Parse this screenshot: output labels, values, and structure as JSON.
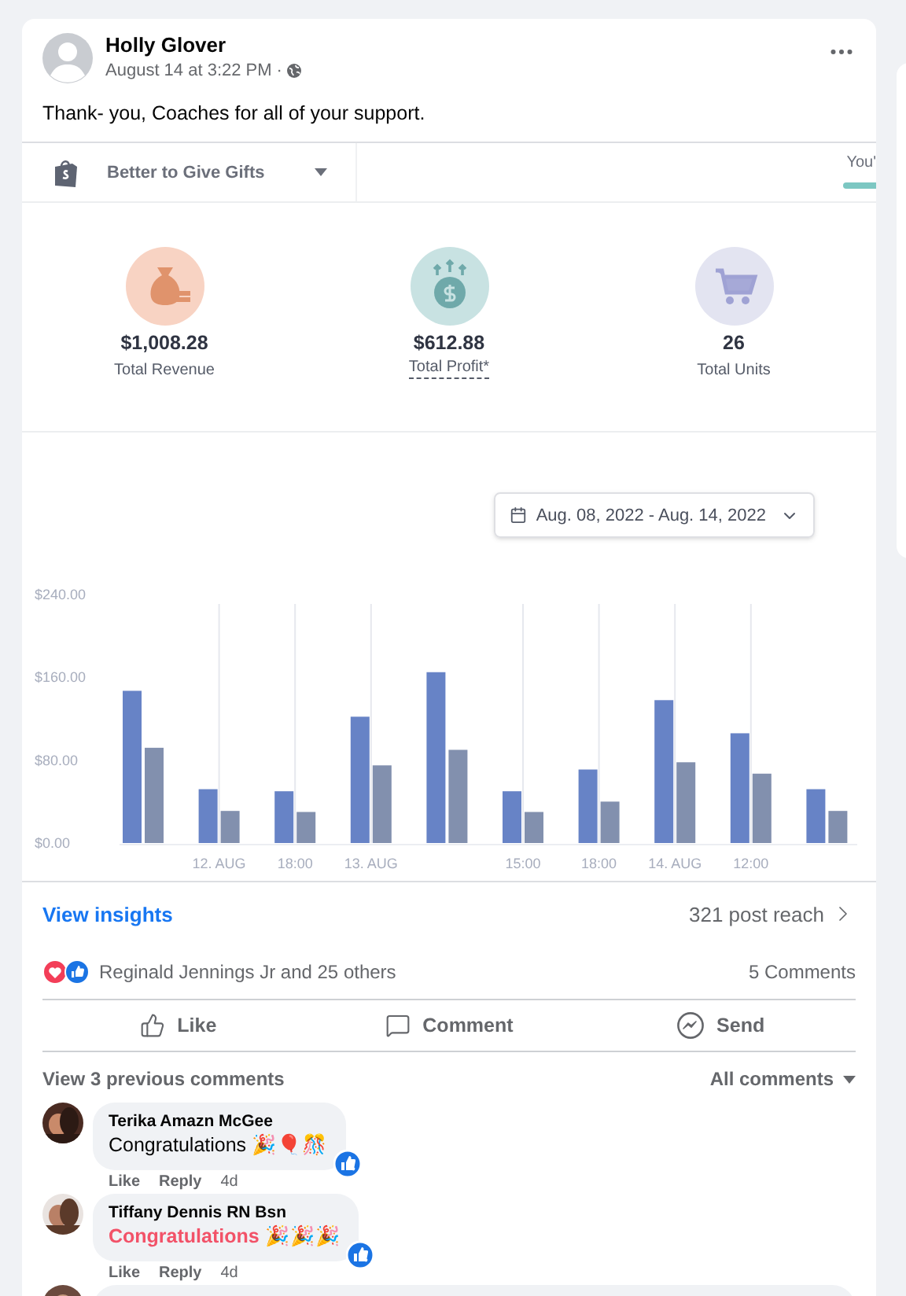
{
  "post": {
    "author": "Holly Glover",
    "time": "August 14 at 3:22 PM",
    "separator": "·",
    "text": "Thank- you, Coaches for all of your support."
  },
  "embed": {
    "store": "Better to Give Gifts",
    "cut_text": "You'",
    "stats": [
      {
        "kind": "revenue",
        "value": "$1,008.28",
        "label": "Total Revenue",
        "dotted": false
      },
      {
        "kind": "profit",
        "value": "$612.88",
        "label": "Total Profit*",
        "dotted": true
      },
      {
        "kind": "units",
        "value": "26",
        "label": "Total Units",
        "dotted": false
      }
    ],
    "date_range": "Aug. 08, 2022 - Aug. 14, 2022",
    "chart_data": {
      "type": "bar",
      "grid": true,
      "categories": [
        null,
        "12. AUG",
        "18:00",
        "13. AUG",
        null,
        "15:00",
        "18:00",
        "14. AUG",
        "12:00",
        null
      ],
      "yticks": [
        {
          "value": 0,
          "label": "$0.00"
        },
        {
          "value": 80,
          "label": "$80.00"
        },
        {
          "value": 160,
          "label": "$160.00"
        },
        {
          "value": 240,
          "label": "$240.00"
        }
      ],
      "ylim": [
        0,
        240
      ],
      "series": [
        {
          "color": "#6783c6",
          "values": [
            147,
            52,
            50,
            122,
            165,
            50,
            71,
            138,
            106,
            52
          ]
        },
        {
          "color": "#8290ae",
          "values": [
            92,
            31,
            30,
            75,
            90,
            30,
            40,
            78,
            67,
            31
          ]
        }
      ]
    }
  },
  "insights": {
    "link": "View insights",
    "reach": "321 post reach"
  },
  "reactions": {
    "text": "Reginald Jennings Jr and 25 others",
    "comments": "5 Comments"
  },
  "actions": [
    {
      "kind": "like",
      "label": "Like"
    },
    {
      "kind": "comment",
      "label": "Comment"
    },
    {
      "kind": "send",
      "label": "Send"
    }
  ],
  "view_previous": "View 3 previous comments",
  "sort": "All comments",
  "comments": [
    {
      "name": "Terika Amazn McGee",
      "text": "Congratulations 🎉🎈🎊",
      "color": "#050505",
      "liked": true,
      "actions": [
        "Like",
        "Reply"
      ],
      "age": "4d"
    },
    {
      "name": "Tiffany Dennis RN Bsn",
      "text": "Congratulations 🎉🎉🎉",
      "color": "#f25268",
      "liked": true,
      "actions": [
        "Like",
        "Reply"
      ],
      "age": "4d"
    }
  ]
}
